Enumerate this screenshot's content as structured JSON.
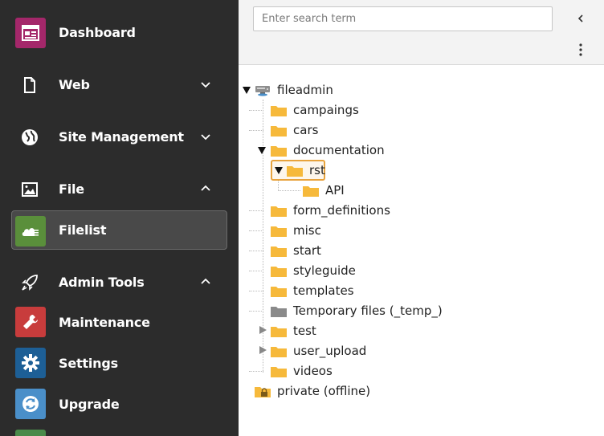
{
  "sidebar": {
    "modules": [
      {
        "label": "Dashboard",
        "icon": "dashboard-icon",
        "color": "#a4276a",
        "expandable": false
      },
      {
        "label": "Web",
        "icon": "page-icon",
        "expandable": true,
        "expanded": false
      },
      {
        "label": "Site Management",
        "icon": "globe-icon",
        "expandable": true,
        "expanded": false
      },
      {
        "label": "File",
        "icon": "image-icon",
        "expandable": true,
        "expanded": true
      },
      {
        "label": "Filelist",
        "icon": "filelist-icon",
        "color": "#5a8f3b",
        "active": true
      },
      {
        "label": "Admin Tools",
        "icon": "rocket-icon",
        "expandable": true,
        "expanded": true
      },
      {
        "label": "Maintenance",
        "icon": "wrench-icon",
        "color": "#c83c3c"
      },
      {
        "label": "Settings",
        "icon": "gear-icon",
        "color": "#1d5f96"
      },
      {
        "label": "Upgrade",
        "icon": "refresh-icon",
        "color": "#4a8fc9"
      }
    ]
  },
  "search": {
    "placeholder": "Enter search term",
    "value": ""
  },
  "tree": {
    "root": "fileadmin",
    "children": [
      "campaings",
      "cars",
      "documentation",
      "rst",
      "API",
      "form_definitions",
      "misc",
      "start",
      "styleguide",
      "templates",
      "Temporary files (_temp_)",
      "test",
      "user_upload",
      "videos"
    ],
    "private": "private (offline)"
  },
  "colors": {
    "folder": "#f6b93b",
    "folder_gray": "#8a8a8a",
    "selected_border": "#e8a33d"
  }
}
